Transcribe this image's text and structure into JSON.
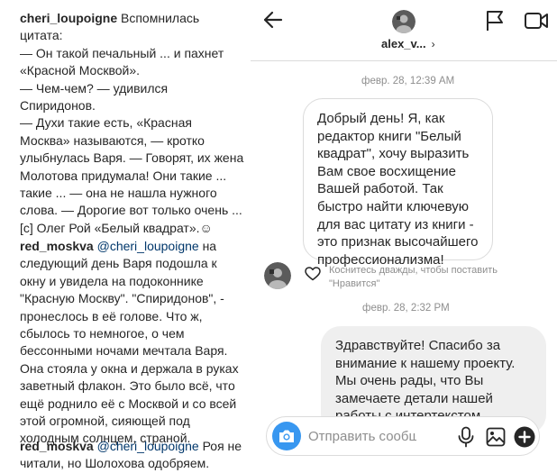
{
  "comments": [
    {
      "username": "cheri_loupoigne",
      "mention": "",
      "text": " Вспомнилась цитата:\n— Он такой печальный ... и пахнет «Красной Москвой».\n— Чем-чем? — удивился Спиридонов.\n— Духи такие есть, «Красная Москва» называются, — кротко улыбнулась Варя. — Говорят, их жена Молотова придумала! Они такие ... такие ... — она не нашла нужного слова. — Дорогие вот только очень ... [c] Олег Рой «Белый квадрат».☺"
    },
    {
      "username": "red_moskva",
      "mention": "@cheri_loupoigne",
      "text": " на следующий день Варя подошла к окну и увидела на подоконнике \"Красную Москву\". \"Спиридонов\", - пронеслось в её голове. Что ж, сбылось то немногое, о чем бессонными ночами мечтала Варя. Она стояла у окна и держала в руках заветный флакон. Это было всё, что ещё роднило её с Москвой и со всей этой огромной, сияющей под холодным солнцем, страной."
    },
    {
      "username": "red_moskva",
      "mention": "@cheri_loupoigne",
      "text": " Роя не читали, но Шолохова одобряем."
    }
  ],
  "dm": {
    "header": {
      "username": "alex_v...",
      "chevron": "›",
      "back_icon": "arrow-left-icon",
      "flag_icon": "flag-icon",
      "video_icon": "video-camera-icon"
    },
    "messages": [
      {
        "timestamp": "февр. 28, 12:39 AM",
        "direction": "incoming",
        "text": "Добрый день! Я, как\nредактор книги \"Белый\nквадрат\", хочу выразить\nВам свое восхищение\nВашей работой. Так\nбыстро найти ключевую\nдля вас цитату из книги -\nэто признак высочайшего\nпрофессионализма!",
        "like_hint": "Коснитесь дважды, чтобы поставить\n\"Нравится\""
      },
      {
        "timestamp": "февр. 28, 2:32 PM",
        "direction": "outgoing",
        "text": "Здравствуйте! Спасибо за\nвнимание к нашему проекту.\nМы очень рады, что Вы\nзамечаете детали нашей\nработы с интертекстом"
      }
    ],
    "composer": {
      "placeholder": "Отправить сообщ...",
      "camera_icon": "camera-icon",
      "mic_icon": "microphone-icon",
      "image_icon": "image-icon",
      "plus_icon": "plus-circle-icon"
    }
  },
  "colors": {
    "text": "#262626",
    "muted": "#8e8e8e",
    "mention": "#00376b",
    "border": "#dbdbdb",
    "outgoing_bubble": "#efefef",
    "camera_button": "#3897f0"
  }
}
